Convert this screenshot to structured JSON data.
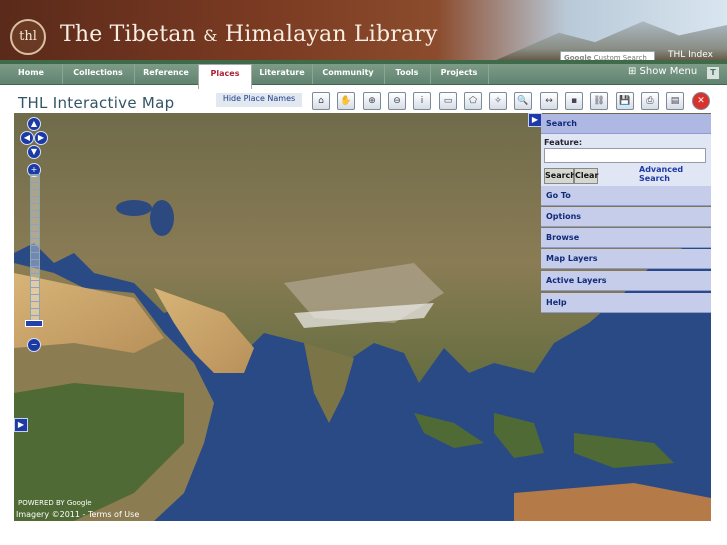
{
  "header": {
    "logo_text": "thl",
    "title_part1": "The Tibetan",
    "title_amp": "&",
    "title_part2": "Himalayan Library",
    "google_search_placeholder": "Custom Search",
    "google_label": "Google",
    "thl_index": "THL Index"
  },
  "nav": {
    "items": [
      "Home",
      "Collections",
      "Reference",
      "Places",
      "Literature",
      "Community",
      "Tools",
      "Projects"
    ],
    "active": "Places",
    "show_menu": "⊞ Show Menu",
    "t_button": "T"
  },
  "page": {
    "title": "THL Interactive Map",
    "hide_place_names": "Hide Place Names"
  },
  "toolbar": [
    {
      "icon": "home-icon",
      "glyph": "⌂"
    },
    {
      "icon": "pan-hand-icon",
      "glyph": "✋"
    },
    {
      "icon": "zoom-box-icon",
      "glyph": "⊕"
    },
    {
      "icon": "zoom-out-icon",
      "glyph": "⊖"
    },
    {
      "icon": "info-icon",
      "glyph": "i"
    },
    {
      "icon": "select-area-icon",
      "glyph": "▭"
    },
    {
      "icon": "select-polygon-icon",
      "glyph": "⬠"
    },
    {
      "icon": "navigate-icon",
      "glyph": "✧"
    },
    {
      "icon": "find-icon",
      "glyph": "🔍"
    },
    {
      "icon": "measure-icon",
      "glyph": "↔"
    },
    {
      "icon": "layer-icon",
      "glyph": "▪"
    },
    {
      "icon": "link-icon",
      "glyph": "⛓"
    },
    {
      "icon": "save-icon",
      "glyph": "💾"
    },
    {
      "icon": "print-icon",
      "glyph": "⎙"
    },
    {
      "icon": "notes-icon",
      "glyph": "▤"
    },
    {
      "icon": "close-icon",
      "glyph": "✕"
    }
  ],
  "map": {
    "credit": "Imagery ©2011 - Terms of Use",
    "powered_by": "POWERED BY Google"
  },
  "search_panel": {
    "header": "Search",
    "feature_label": "Feature:",
    "feature_value": "",
    "search_button": "Search",
    "clear_button": "Clear",
    "advanced_search": "Advanced Search",
    "sections": [
      "Go To",
      "Options",
      "Browse",
      "Map Layers",
      "Active Layers",
      "Help"
    ]
  },
  "colors": {
    "ocean": "#2e4c87",
    "panel_bg": "#c6cdea",
    "nav_bg": "#6d8f7b",
    "active_nav_text": "#b0213a"
  }
}
